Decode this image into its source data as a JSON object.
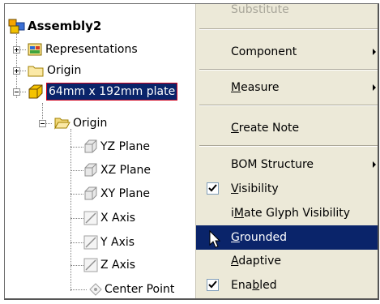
{
  "browser": {
    "root_label": "Assembly2",
    "items": [
      {
        "label": "Representations"
      },
      {
        "label": "Origin"
      },
      {
        "label": "64mm x 192mm plate"
      },
      {
        "label": "Origin"
      },
      {
        "label": "YZ Plane"
      },
      {
        "label": "XZ Plane"
      },
      {
        "label": "XY Plane"
      },
      {
        "label": "X Axis"
      },
      {
        "label": "Y Axis"
      },
      {
        "label": "Z Axis"
      },
      {
        "label": "Center Point"
      }
    ]
  },
  "context_menu": {
    "items": {
      "substitute": {
        "label": "Substitute"
      },
      "component": {
        "label": "Component"
      },
      "measure": {
        "label": "Measure",
        "mnemonic": "M",
        "rest": "easure"
      },
      "create_note": {
        "label": "Create Note",
        "mnemonic": "C",
        "rest": "reate Note"
      },
      "bom_structure": {
        "label": "BOM Structure"
      },
      "visibility": {
        "label": "Visibility",
        "mnemonic": "V",
        "rest": "isibility",
        "checked": true
      },
      "imate_glyph": {
        "label": "iMate Glyph Visibility",
        "pre": "i",
        "mnemonic": "M",
        "rest": "ate Glyph Visibility"
      },
      "grounded": {
        "label": "Grounded",
        "mnemonic": "G",
        "rest": "rounded",
        "highlighted": true
      },
      "adaptive": {
        "label": "Adaptive",
        "mnemonic": "A",
        "rest": "daptive"
      },
      "enabled": {
        "label": "Enabled",
        "pre": "Ena",
        "mnemonic": "b",
        "rest": "led",
        "checked": true
      }
    },
    "highlight_color": "#0a246a",
    "background_color": "#ece9d8"
  }
}
